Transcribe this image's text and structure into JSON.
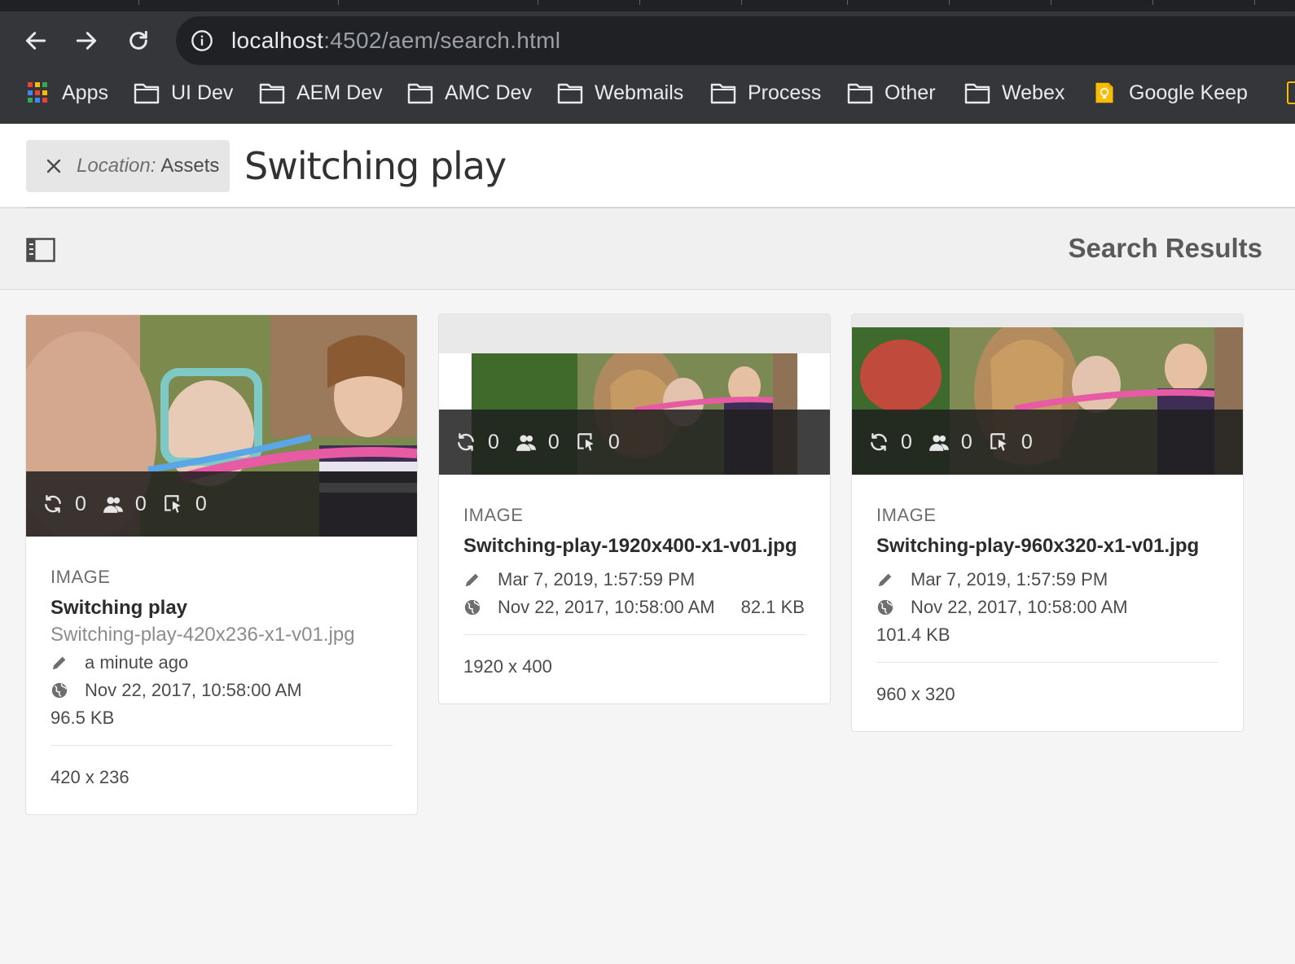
{
  "browser": {
    "url_host": "localhost",
    "url_path": ":4502/aem/search.html",
    "bookmarks": [
      {
        "label": "Apps",
        "icon": "apps-grid-icon"
      },
      {
        "label": "UI Dev",
        "icon": "folder-icon"
      },
      {
        "label": "AEM Dev",
        "icon": "folder-icon"
      },
      {
        "label": "AMC Dev",
        "icon": "folder-icon"
      },
      {
        "label": "Webmails",
        "icon": "folder-icon"
      },
      {
        "label": "Process",
        "icon": "folder-icon"
      },
      {
        "label": "Other",
        "icon": "folder-icon"
      },
      {
        "label": "Webex",
        "icon": "folder-icon"
      },
      {
        "label": "Google Keep",
        "icon": "google-keep-icon"
      }
    ]
  },
  "search": {
    "tag_label": "Location:",
    "tag_value": "Assets",
    "query": "Switching play"
  },
  "actionbar": {
    "title": "Search Results"
  },
  "cards": [
    {
      "type": "IMAGE",
      "title": "Switching play",
      "filename": "Switching-play-420x236-x1-v01.jpg",
      "modified": "a minute ago",
      "published": "Nov 22, 2017, 10:58:00 AM",
      "size": "96.5 KB",
      "dimensions": "420 x 236",
      "stats": {
        "versions": "0",
        "reviews": "0",
        "clicks": "0"
      }
    },
    {
      "type": "IMAGE",
      "title": "Switching-play-1920x400-x1-v01.jpg",
      "modified": "Mar 7, 2019, 1:57:59 PM",
      "published": "Nov 22, 2017, 10:58:00 AM",
      "size": "82.1 KB",
      "dimensions": "1920 x 400",
      "stats": {
        "versions": "0",
        "reviews": "0",
        "clicks": "0"
      }
    },
    {
      "type": "IMAGE",
      "title": "Switching-play-960x320-x1-v01.jpg",
      "modified": "Mar 7, 2019, 1:57:59 PM",
      "published": "Nov 22, 2017, 10:58:00 AM",
      "size": "101.4 KB",
      "dimensions": "960 x 320",
      "stats": {
        "versions": "0",
        "reviews": "0",
        "clicks": "0"
      }
    }
  ],
  "colors": {
    "chrome_bg": "#35363a",
    "omnibox_bg": "#202124",
    "page_bg": "#f5f5f5",
    "card_bg": "#ffffff",
    "stats_bar": "#1e1e1e"
  }
}
